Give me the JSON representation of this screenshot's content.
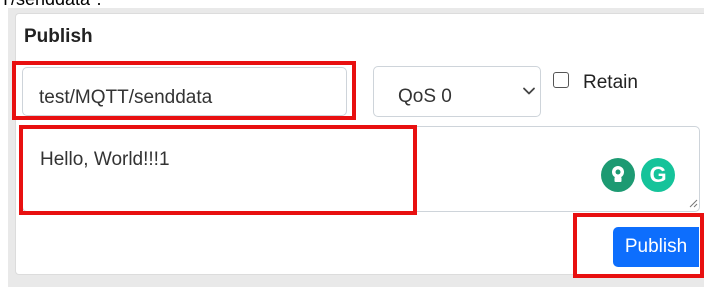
{
  "header_fragment": "T/senddata\".",
  "card": {
    "title": "Publish"
  },
  "topic": {
    "value": "test/MQTT/senddata"
  },
  "qos": {
    "selected": "QoS 0"
  },
  "retain": {
    "label": "Retain",
    "checked": false
  },
  "message": {
    "value": "Hello, World!!!1"
  },
  "extension": {
    "grammarly_letter": "G"
  },
  "publish_button": {
    "label": "Publish"
  },
  "icons": [
    "chevron-down-icon",
    "lightbulb-icon",
    "grammarly-icon",
    "resize-handle-icon"
  ],
  "colors": {
    "accent": "#0d6efd",
    "highlight": "#e81010",
    "grammarly": "#15c39a"
  }
}
